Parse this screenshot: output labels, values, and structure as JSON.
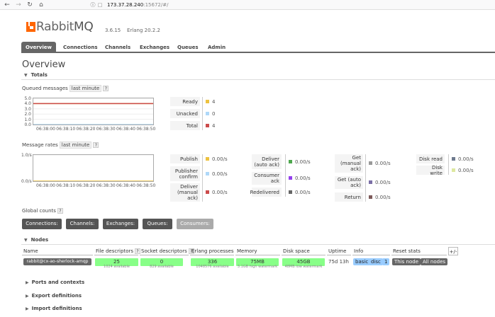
{
  "browser": {
    "back_icon": "arrow-left-icon",
    "forward_icon": "arrow-right-icon",
    "reload_icon": "reload-icon",
    "home_icon": "home-icon",
    "url_host": "173.37.28.240",
    "url_rest": ":15672/#/"
  },
  "header": {
    "logo_prefix": "Rabbit",
    "logo_suffix": "MQ",
    "version": "3.6.15",
    "erlang": "Erlang 20.2.2"
  },
  "tabs": [
    {
      "label": "Overview",
      "active": true
    },
    {
      "label": "Connections"
    },
    {
      "label": "Channels"
    },
    {
      "label": "Exchanges"
    },
    {
      "label": "Queues"
    },
    {
      "label": "Admin"
    }
  ],
  "page_title": "Overview",
  "totals": {
    "heading": "Totals",
    "queued_label": "Queued messages",
    "queued_range": "last minute",
    "rates_label": "Message rates",
    "rates_range": "last minute",
    "help": "?"
  },
  "colors": {
    "ready": "#edc240",
    "unacked": "#afd8f8",
    "total": "#cb4b4b",
    "publish": "#edc240",
    "publisher_confirm": "#afd8f8",
    "deliver_manual": "#cb4b4b",
    "deliver_auto": "#4da74d",
    "consumer_ack": "#9440ed",
    "redelivered": "#666666",
    "get_manual": "#999999",
    "get_auto": "#7b6fa6",
    "return": "#7d5a5a",
    "disk_read": "#6f7b8f",
    "disk_write": "#dde8a0"
  },
  "chart_data": [
    {
      "type": "line",
      "title": "Queued messages",
      "x": [
        "06:38:00",
        "06:38:10",
        "06:38:20",
        "06:38:30",
        "06:38:40",
        "06:38:50"
      ],
      "yticks": [
        "5.0",
        "4.0",
        "3.0",
        "2.0",
        "1.0",
        "0.0"
      ],
      "ylim": [
        0,
        5
      ],
      "series": [
        {
          "name": "Ready",
          "values": [
            4,
            4,
            4,
            4,
            4,
            4
          ]
        },
        {
          "name": "Unacked",
          "values": [
            0,
            0,
            0,
            0,
            0,
            0
          ]
        },
        {
          "name": "Total",
          "values": [
            4,
            4,
            4,
            4,
            4,
            4
          ]
        }
      ]
    },
    {
      "type": "line",
      "title": "Message rates",
      "x": [
        "06:38:00",
        "06:38:10",
        "06:38:20",
        "06:38:30",
        "06:38:40",
        "06:38:50"
      ],
      "yticks": [
        "1.0/s",
        "0.0/s"
      ],
      "ylim": [
        0,
        1
      ],
      "series": [
        {
          "name": "Publish",
          "values": [
            0,
            0,
            0,
            0,
            0,
            0
          ]
        }
      ]
    }
  ],
  "queued_stats": [
    {
      "label": "Ready",
      "value": "4"
    },
    {
      "label": "Unacked",
      "value": "0"
    },
    {
      "label": "Total",
      "value": "4"
    }
  ],
  "rate_stats": {
    "col1": [
      {
        "label": "Publish",
        "value": "0.00/s"
      },
      {
        "label": "Publisher confirm",
        "value": "0.00/s"
      },
      {
        "label": "Deliver (manual ack)",
        "value": "0.00/s"
      }
    ],
    "col2": [
      {
        "label": "Deliver (auto ack)",
        "value": "0.00/s"
      },
      {
        "label": "Consumer ack",
        "value": "0.00/s"
      },
      {
        "label": "Redelivered",
        "value": "0.00/s"
      }
    ],
    "col3": [
      {
        "label": "Get (manual ack)",
        "value": "0.00/s"
      },
      {
        "label": "Get (auto ack)",
        "value": "0.00/s"
      },
      {
        "label": "Return",
        "value": "0.00/s"
      }
    ],
    "col4": [
      {
        "label": "Disk read",
        "value": "0.00/s"
      },
      {
        "label": "Disk write",
        "value": "0.00/s"
      }
    ]
  },
  "global_counts": {
    "label": "Global counts",
    "connections": "Connections: 0",
    "channels": "Channels: 0",
    "exchanges": "Exchanges: 9",
    "queues": "Queues: 2",
    "consumers": "Consumers: 0"
  },
  "nodes": {
    "heading": "Nodes",
    "columns": [
      "Name",
      "File descriptors",
      "Socket descriptors",
      "Erlang processes",
      "Memory",
      "Disk space",
      "Uptime",
      "Info",
      "Reset stats",
      "+/-"
    ],
    "row": {
      "name": "rabbit@cx-ao-sherlock-amqp",
      "fd": "25",
      "fd_sub": "1024 available",
      "sd": "0",
      "sd_sub": "829 available",
      "erl": "336",
      "erl_sub": "1048576 available",
      "mem": "75MB",
      "mem_sub": "3.1GB high watermark",
      "disk": "45GB",
      "disk_sub": "48MB low watermark",
      "uptime": "75d 13h",
      "info1": "basic",
      "info2": "disc",
      "info3": "1",
      "reset1": "This node",
      "reset2": "All nodes"
    }
  },
  "collapsed": [
    "Ports and contexts",
    "Export definitions",
    "Import definitions"
  ]
}
